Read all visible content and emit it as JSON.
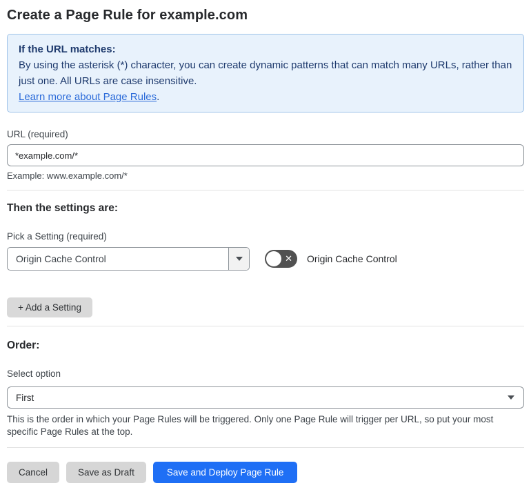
{
  "page": {
    "title": "Create a Page Rule for example.com"
  },
  "info_box": {
    "heading": "If the URL matches:",
    "body": "By using the asterisk (*) character, you can create dynamic patterns that can match many URLs, rather than just one. All URLs are case insensitive.",
    "link_label": "Learn more about Page Rules",
    "link_suffix": "."
  },
  "url_field": {
    "label": "URL (required)",
    "value": "*example.com/*",
    "example": "Example: www.example.com/*"
  },
  "settings_section": {
    "heading": "Then the settings are:",
    "picker_label": "Pick a Setting (required)",
    "picker_value": "Origin Cache Control",
    "toggle": {
      "state": "off",
      "glyph": "✕",
      "label": "Origin Cache Control"
    },
    "add_setting_label": "+ Add a Setting"
  },
  "order_section": {
    "heading": "Order:",
    "select_label": "Select option",
    "select_value": "First",
    "help_text": "This is the order in which your Page Rules will be triggered. Only one Page Rule will trigger per URL, so put your most specific Page Rules at the top."
  },
  "footer": {
    "cancel_label": "Cancel",
    "save_draft_label": "Save as Draft",
    "save_deploy_label": "Save and Deploy Page Rule"
  },
  "colors": {
    "accent_blue": "#1f6ff5",
    "info_background": "#e8f2fc",
    "info_border": "#9ec2e8",
    "info_text": "#1e3a6d",
    "link_blue": "#2b6bd9",
    "toggle_background": "#515151",
    "button_gray": "#d6d6d6"
  }
}
